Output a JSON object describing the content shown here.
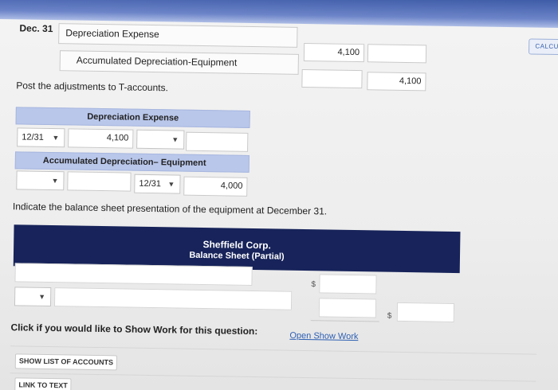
{
  "calculator": {
    "label": "CALCU"
  },
  "journal": {
    "date": "Dec. 31",
    "debit_account": "Depreciation Expense",
    "debit_amount": "4,100",
    "credit_account": "Accumulated Depreciation-Equipment",
    "credit_amount": "4,100"
  },
  "taccounts": {
    "instruction": "Post the adjustments to T-accounts.",
    "dep_expense": {
      "title": "Depreciation Expense",
      "date_selected": "12/31",
      "debit_amount": "4,100",
      "credit_date_selected": "",
      "credit_amount": ""
    },
    "accum_dep": {
      "title": "Accumulated Depreciation– Equipment",
      "debit_date_selected": "",
      "debit_amount": "",
      "credit_date_selected": "12/31",
      "credit_amount": "4,000"
    }
  },
  "balance_sheet": {
    "instruction": "Indicate the balance sheet presentation of the equipment at December 31.",
    "company": "Sheffield Corp.",
    "statement": "Balance Sheet (Partial)",
    "line1_label": "",
    "line1_amount": "",
    "line2_select": "",
    "line2_label": "",
    "line2_amount": "",
    "total_amount": "",
    "currency_symbol": "$"
  },
  "show_work": {
    "prompt": "Click if you would like to Show Work for this question:",
    "link": "Open Show Work"
  },
  "buttons": {
    "show_list": "SHOW LIST OF ACCOUNTS",
    "link_to_text": "LINK TO TEXT"
  }
}
